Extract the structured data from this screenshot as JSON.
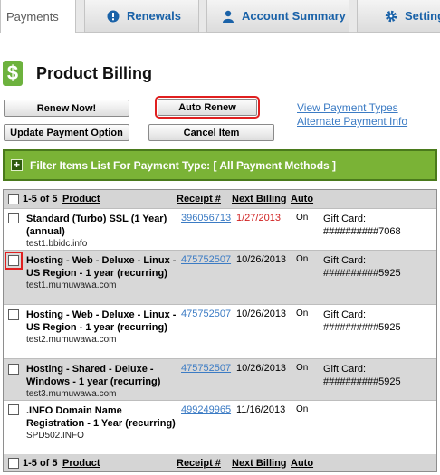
{
  "tabs": [
    {
      "label": "Payments",
      "icon": ""
    },
    {
      "label": "Renewals",
      "icon": "alert-icon"
    },
    {
      "label": "Account Summary",
      "icon": "person-icon"
    },
    {
      "label": "Setting",
      "icon": "gear-icon"
    }
  ],
  "page": {
    "title": "Product Billing",
    "icon": "dollar-icon"
  },
  "buttons": {
    "renew_now": "Renew Now!",
    "auto_renew": "Auto Renew",
    "update_payment": "Update Payment Option",
    "cancel_item": "Cancel Item"
  },
  "links": {
    "view_payment_types": "View Payment Types",
    "alternate_payment": "Alternate Payment Info"
  },
  "filter": {
    "label": "Filter Items List For Payment Type: [ All Payment Methods ]"
  },
  "table": {
    "range": "1-5 of 5",
    "columns": {
      "product": "Product",
      "receipt": "Receipt #",
      "next_billing": "Next Billing",
      "auto": "Auto"
    },
    "rows": [
      {
        "product": "Standard (Turbo) SSL (1 Year) (annual)",
        "domain": "test1.bbidc.info",
        "receipt": "396056713",
        "next_billing": "1/27/2013",
        "auto": "On",
        "payment_label": "Gift Card:",
        "payment_value": "##########7068"
      },
      {
        "product": "Hosting - Web - Deluxe - Linux - US Region - 1 year (recurring)",
        "domain": "test1.mumuwawa.com",
        "receipt": "475752507",
        "next_billing": "10/26/2013",
        "auto": "On",
        "payment_label": "Gift Card:",
        "payment_value": "##########5925"
      },
      {
        "product": "Hosting - Web - Deluxe - Linux - US Region - 1 year (recurring)",
        "domain": "test2.mumuwawa.com",
        "receipt": "475752507",
        "next_billing": "10/26/2013",
        "auto": "On",
        "payment_label": "Gift Card:",
        "payment_value": "##########5925"
      },
      {
        "product": "Hosting - Shared - Deluxe - Windows - 1 year (recurring)",
        "domain": "test3.mumuwawa.com",
        "receipt": "475752507",
        "next_billing": "10/26/2013",
        "auto": "On",
        "payment_label": "Gift Card:",
        "payment_value": "##########5925"
      },
      {
        "product": ".INFO Domain Name Registration - 1 Year (recurring)",
        "domain": "SPD502.INFO",
        "receipt": "499249965",
        "next_billing": "11/16/2013",
        "auto": "On",
        "payment_label": "",
        "payment_value": ""
      }
    ]
  },
  "colors": {
    "accent_link": "#3b7bc4",
    "filter_green": "#7ab336",
    "highlight_red": "#e02020",
    "past_due_red": "#d02020"
  }
}
